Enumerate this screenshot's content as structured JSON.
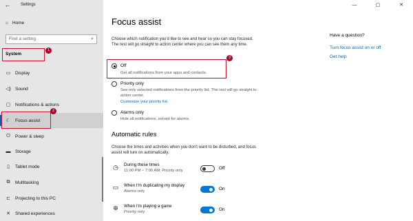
{
  "titlebar": {
    "title": "Settings",
    "back_icon": "back-arrow-icon",
    "minimize": "—",
    "maximize": "▢",
    "close": "✕"
  },
  "sidebar": {
    "home_label": "Home",
    "search_placeholder": "Find a setting",
    "section_title": "System",
    "items": [
      {
        "label": "Display",
        "icon": "display-icon"
      },
      {
        "label": "Sound",
        "icon": "speaker-icon"
      },
      {
        "label": "Notifications & actions",
        "icon": "notifications-icon"
      },
      {
        "label": "Focus assist",
        "icon": "moon-icon"
      },
      {
        "label": "Power & sleep",
        "icon": "power-icon"
      },
      {
        "label": "Storage",
        "icon": "storage-icon"
      },
      {
        "label": "Tablet mode",
        "icon": "tablet-icon"
      },
      {
        "label": "Multitasking",
        "icon": "multitasking-icon"
      },
      {
        "label": "Projecting to this PC",
        "icon": "projecting-icon"
      },
      {
        "label": "Shared experiences",
        "icon": "shared-icon"
      }
    ]
  },
  "badges": {
    "one": "1",
    "two": "2",
    "three": "3"
  },
  "main": {
    "title": "Focus assist",
    "description": "Choose which notification you'd like to see and hear so you can stay focused. The rest will go straight to action center where you can see them any time.",
    "options": [
      {
        "label": "Off",
        "sub": "Get all notifications from your apps and contacts.",
        "selected": true
      },
      {
        "label": "Priority only",
        "sub": "See only selected notifications from the priority list. The rest will go straight to action center.",
        "link": "Customize your priority list",
        "selected": false
      },
      {
        "label": "Alarms only",
        "sub": "Hide all notifications, except for alarms.",
        "selected": false
      }
    ],
    "auto_title": "Automatic rules",
    "auto_desc": "Choose the times and activities when you don't want to be disturbed, and focus assist will turn on automatically.",
    "rules": [
      {
        "name": "During these times",
        "detail": "11:00 PM – 7:00 AM; Priority only",
        "state": "Off",
        "on": false,
        "icon": "clock-icon"
      },
      {
        "name": "When I'm duplicating my display",
        "detail": "Alarms only",
        "state": "On",
        "on": true,
        "icon": "monitor-icon"
      },
      {
        "name": "When I'm playing a game",
        "detail": "Priority only",
        "state": "On",
        "on": true,
        "icon": "gamepad-icon"
      }
    ]
  },
  "help": {
    "title": "Have a question?",
    "links": [
      "Turn focus assist on or off",
      "Get help"
    ]
  },
  "colors": {
    "accent": "#0078d7",
    "annotation": "#c8102e",
    "sidebar_bg": "#e6e6e6"
  }
}
